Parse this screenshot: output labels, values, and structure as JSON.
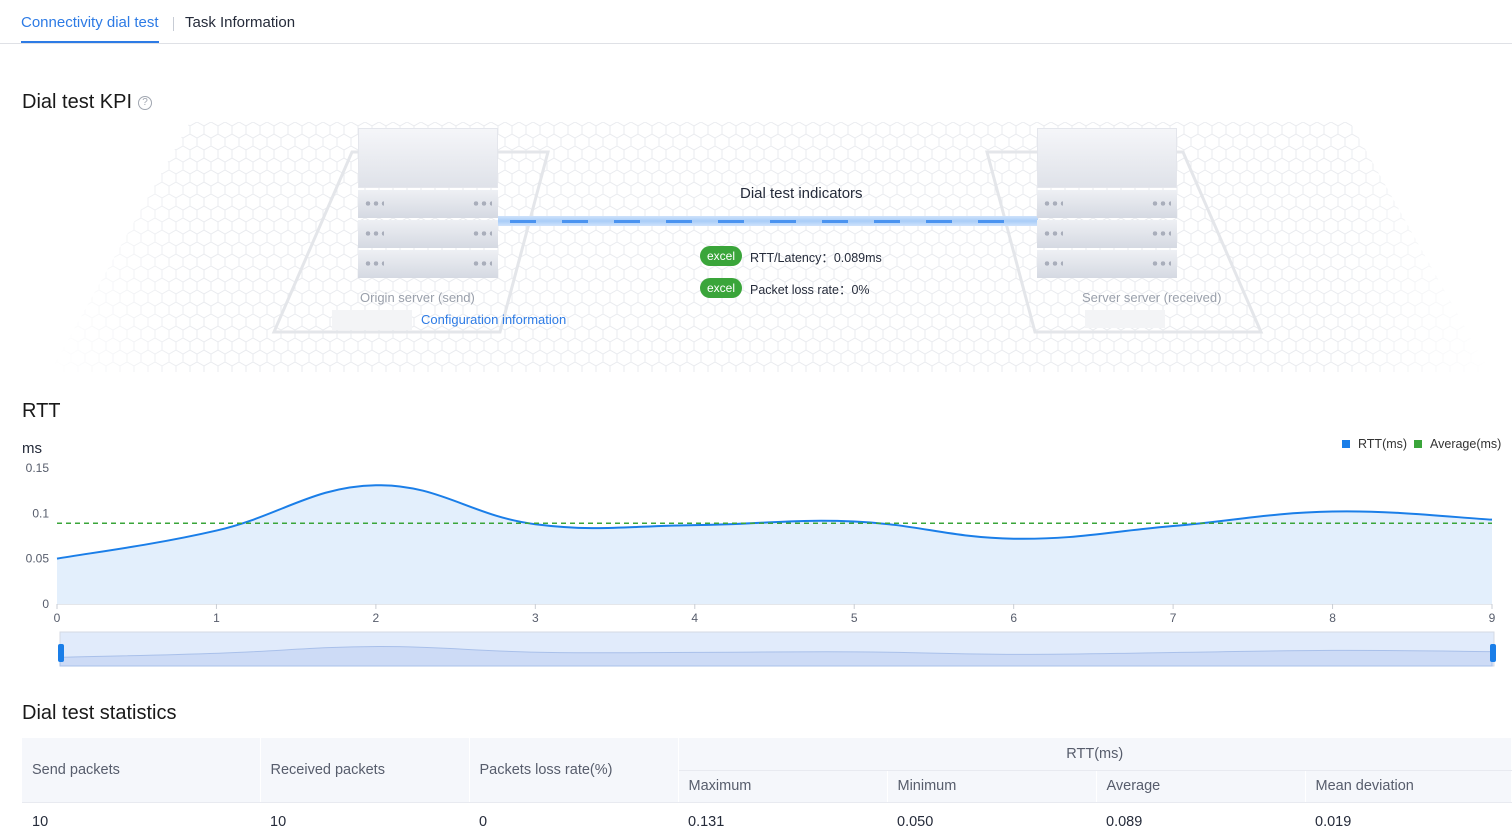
{
  "tabs": [
    {
      "label": "Connectivity dial test",
      "active": true
    },
    {
      "label": "Task Information",
      "active": false
    }
  ],
  "kpi": {
    "title": "Dial test KPI",
    "help_icon": "question-circle-icon",
    "origin_label": "Origin server (send)",
    "config_link": "Configuration information",
    "dest_label": "Server server (received)",
    "indicators_title": "Dial test indicators",
    "indicators": [
      {
        "badge": "excel",
        "text": "RTT/Latency：0.089ms"
      },
      {
        "badge": "excel",
        "text": "Packet loss rate：0%"
      }
    ],
    "colors": {
      "badge": "#3aa53a",
      "link": "#4a93f0"
    }
  },
  "rtt": {
    "title": "RTT",
    "unit": "ms",
    "legend": [
      "RTT(ms)",
      "Average(ms)"
    ],
    "colors": {
      "rtt": "#1a7ee8",
      "average": "#3aa53a",
      "area": "#e3effc"
    }
  },
  "chart_data": {
    "type": "line",
    "x": [
      0,
      1,
      2,
      3,
      4,
      5,
      6,
      7,
      8,
      9
    ],
    "series": [
      {
        "name": "RTT(ms)",
        "values": [
          0.05,
          0.081,
          0.131,
          0.088,
          0.087,
          0.091,
          0.072,
          0.086,
          0.102,
          0.093
        ]
      },
      {
        "name": "Average(ms)",
        "values": [
          0.089,
          0.089,
          0.089,
          0.089,
          0.089,
          0.089,
          0.089,
          0.089,
          0.089,
          0.089
        ]
      }
    ],
    "ylabel": "ms",
    "yticks": [
      0,
      0.05,
      0.1,
      0.15
    ],
    "ylim": [
      0,
      0.15
    ],
    "xlim": [
      0,
      9
    ],
    "legend_position": "top-right",
    "grid": false
  },
  "stats": {
    "title": "Dial test statistics",
    "headers": {
      "send": "Send packets",
      "received": "Received packets",
      "loss": "Packets loss rate(%)",
      "rtt_group": "RTT(ms)",
      "max": "Maximum",
      "min": "Minimum",
      "avg": "Average",
      "dev": "Mean deviation"
    },
    "row": {
      "send": "10",
      "received": "10",
      "loss": "0",
      "max": "0.131",
      "min": "0.050",
      "avg": "0.089",
      "dev": "0.019"
    }
  }
}
